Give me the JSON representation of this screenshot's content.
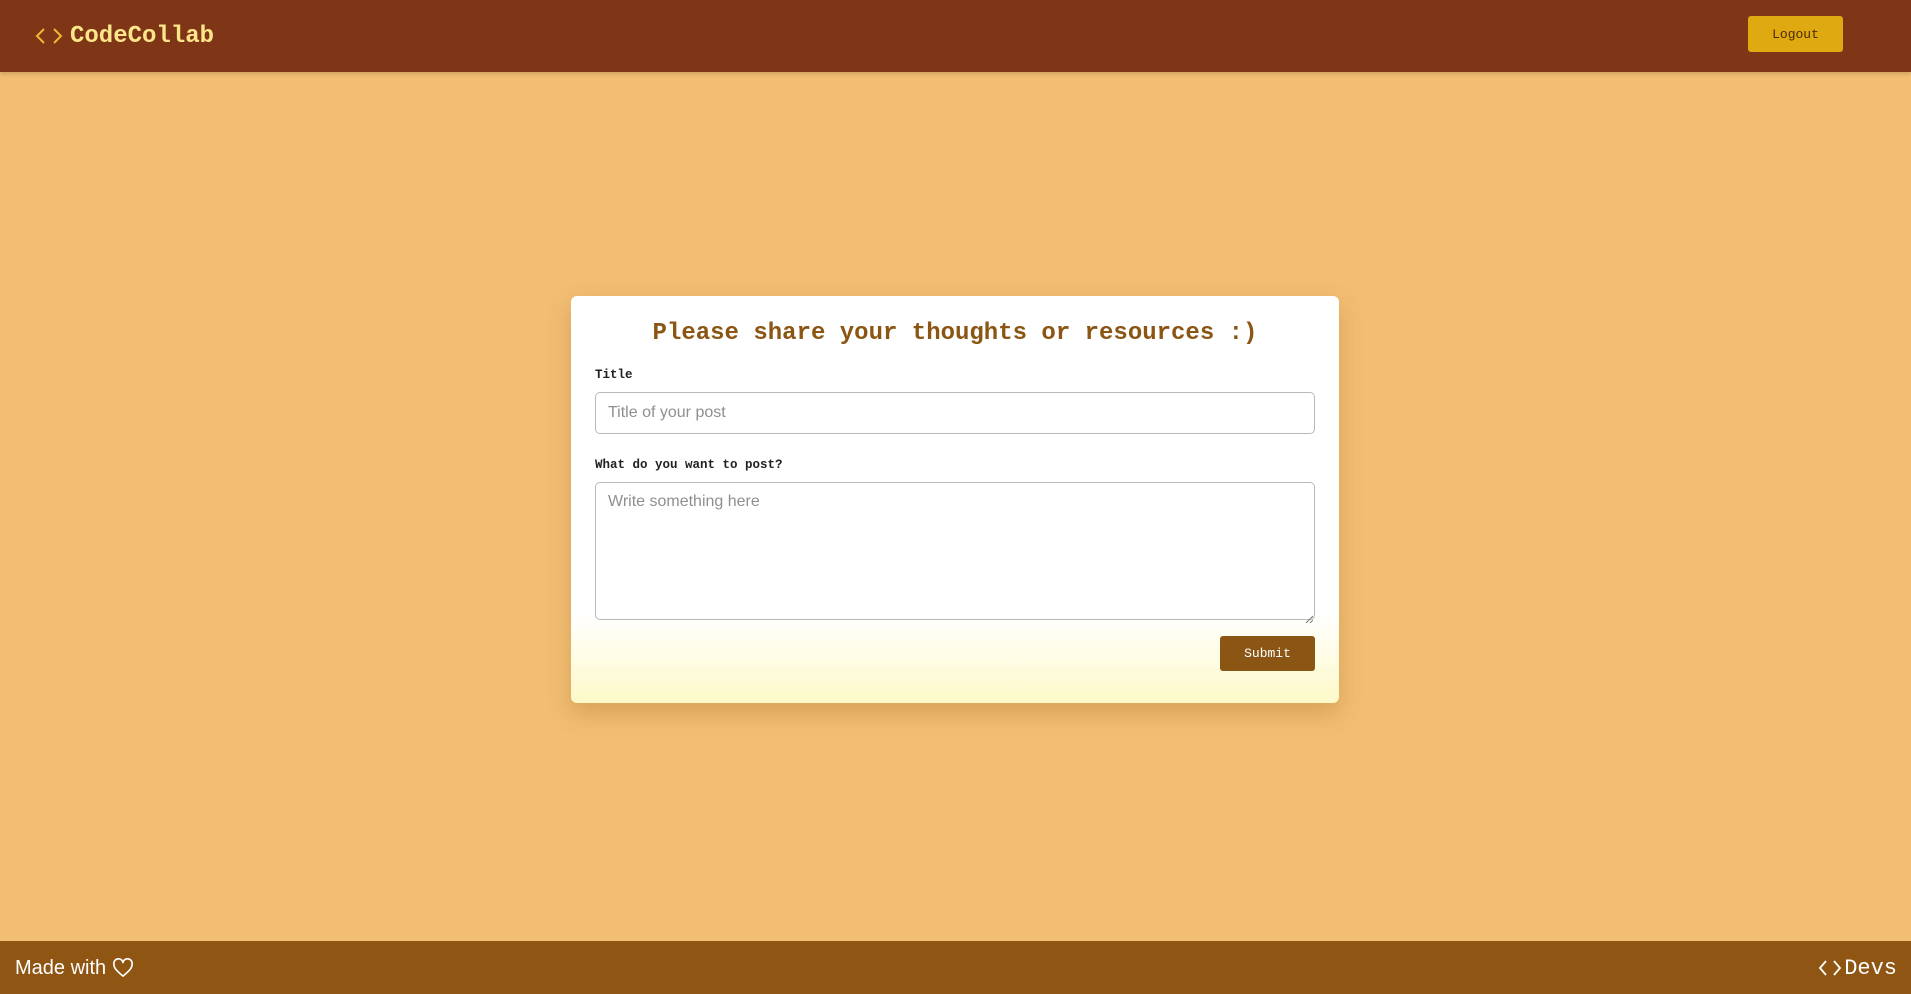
{
  "header": {
    "brand_name": "CodeCollab",
    "brand_icon": "code-brackets-icon",
    "logout_label": "Logout"
  },
  "form": {
    "heading": "Please share your thoughts or resources :)",
    "title_label": "Title",
    "title_placeholder": "Title of your post",
    "title_value": "",
    "body_label": "What do you want to post?",
    "body_placeholder": "Write something here",
    "body_value": "",
    "submit_label": "Submit"
  },
  "footer": {
    "made_with_text": "Made with",
    "heart_icon": "heart-outline-icon",
    "devs_icon": "code-brackets-icon",
    "devs_text": "Devs"
  },
  "colors": {
    "page_background": "#f1be73",
    "navbar": "#7f3616",
    "brand_text": "#fde68a",
    "logout_button": "#dfa911",
    "heading_text": "#8b5513",
    "submit_button": "#8b5513",
    "footer": "#8f5513"
  }
}
